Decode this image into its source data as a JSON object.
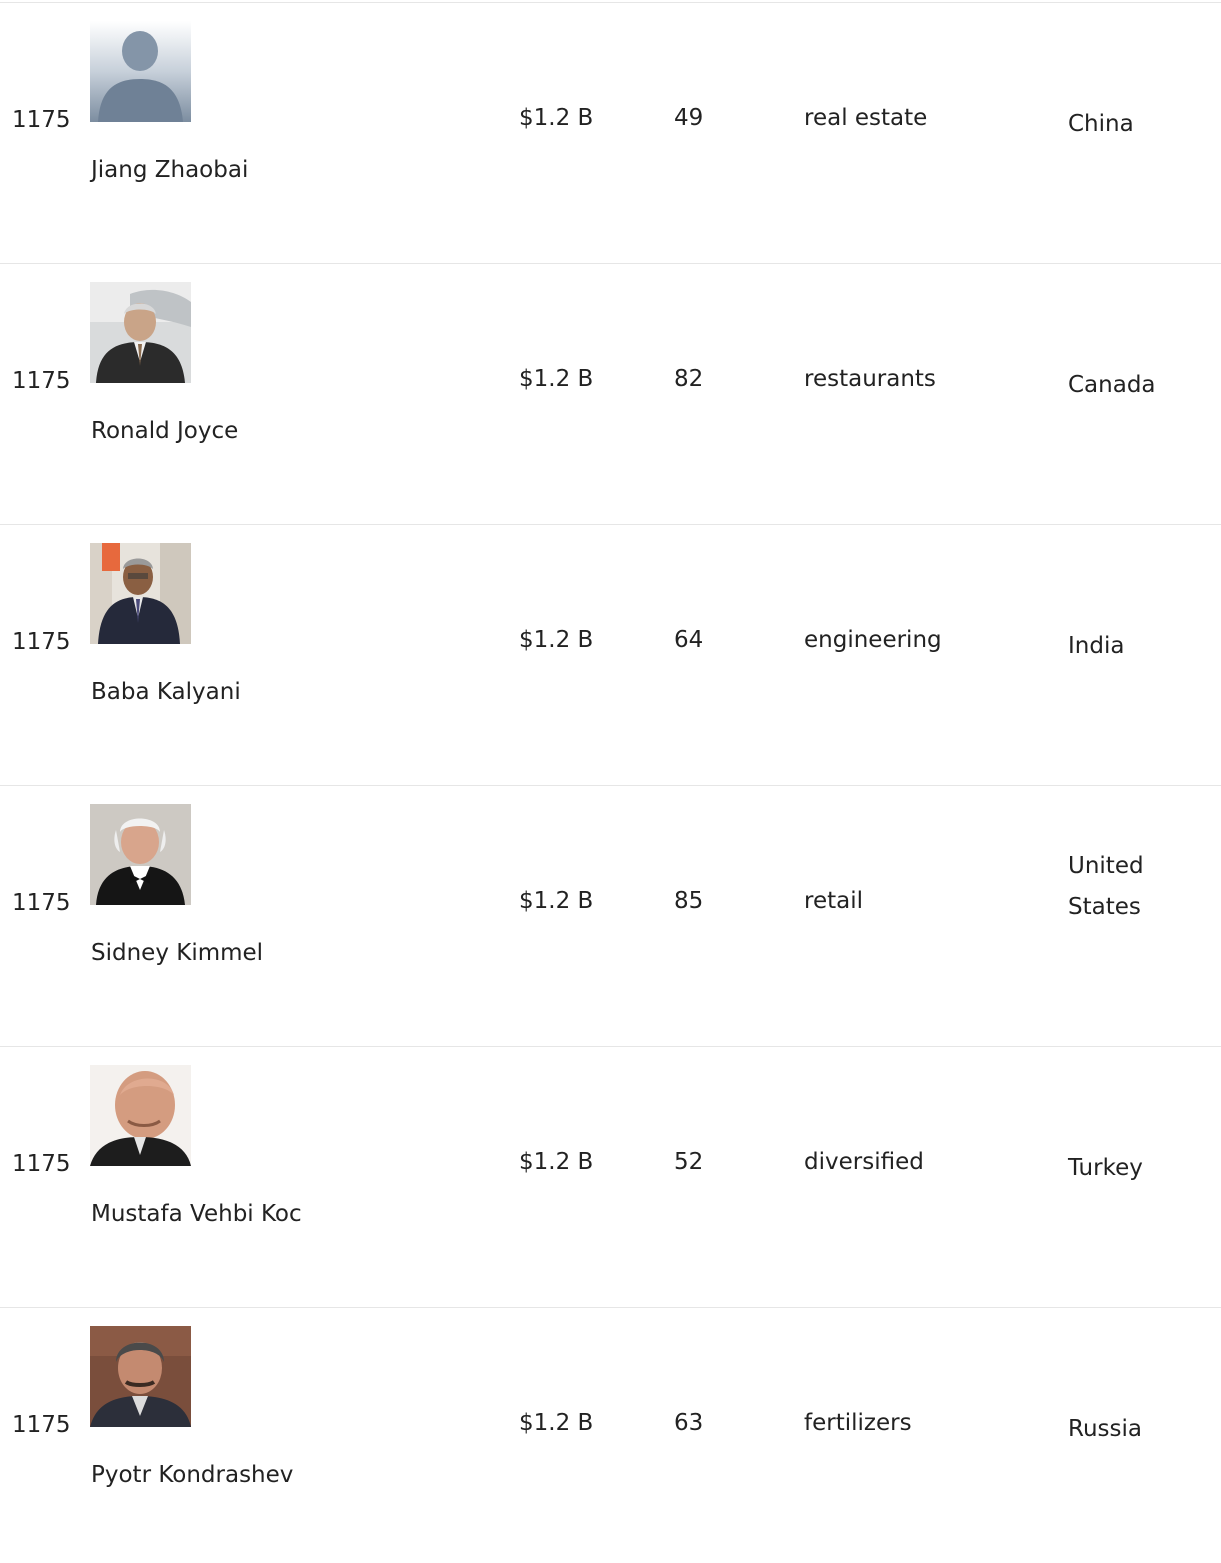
{
  "rows": [
    {
      "rank": "1175",
      "name": "Jiang Zhaobai",
      "net_worth": "$1.2 B",
      "age": "49",
      "industry": "real estate",
      "country": "China",
      "photo": "silhouette-placeholder-icon"
    },
    {
      "rank": "1175",
      "name": "Ronald Joyce",
      "net_worth": "$1.2 B",
      "age": "82",
      "industry": "restaurants",
      "country": "Canada",
      "photo": "person-photo"
    },
    {
      "rank": "1175",
      "name": "Baba Kalyani",
      "net_worth": "$1.2 B",
      "age": "64",
      "industry": "engineering",
      "country": "India",
      "photo": "person-photo"
    },
    {
      "rank": "1175",
      "name": "Sidney Kimmel",
      "net_worth": "$1.2 B",
      "age": "85",
      "industry": "retail",
      "country": "United States",
      "photo": "person-photo"
    },
    {
      "rank": "1175",
      "name": "Mustafa Vehbi Koc",
      "net_worth": "$1.2 B",
      "age": "52",
      "industry": "diversified",
      "country": "Turkey",
      "photo": "person-photo"
    },
    {
      "rank": "1175",
      "name": "Pyotr Kondrashev",
      "net_worth": "$1.2 B",
      "age": "63",
      "industry": "fertilizers",
      "country": "Russia",
      "photo": "person-photo"
    }
  ]
}
